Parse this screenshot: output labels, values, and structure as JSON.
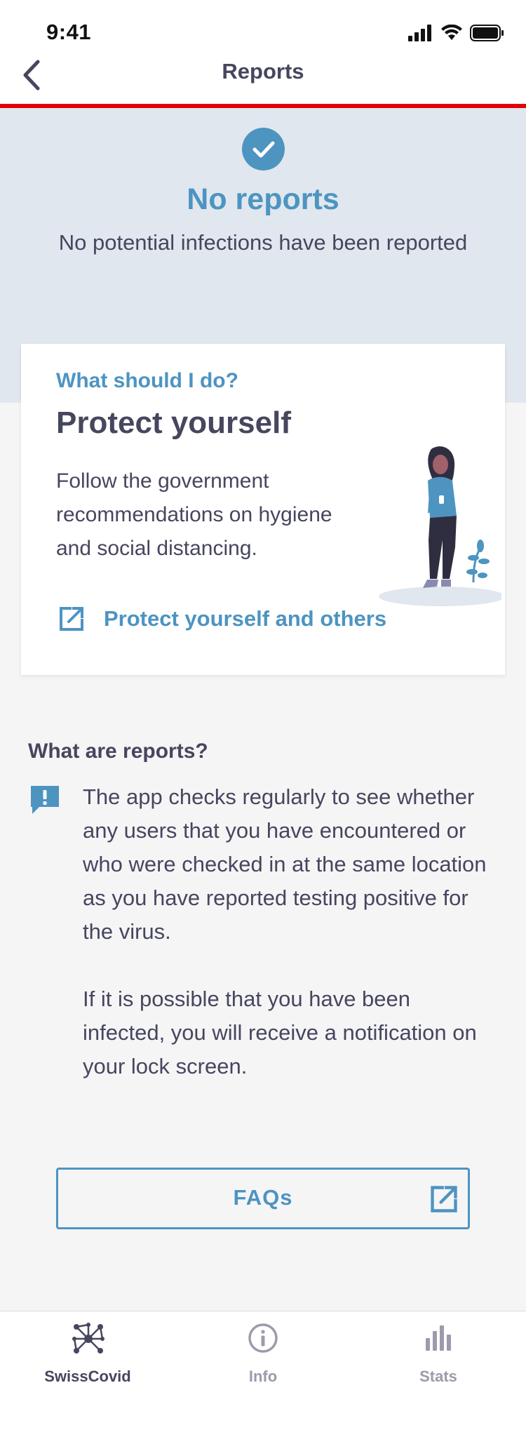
{
  "status_bar": {
    "time": "9:41"
  },
  "navbar": {
    "title": "Reports"
  },
  "header": {
    "title": "No reports",
    "subtitle": "No potential infections have been reported"
  },
  "card": {
    "eyebrow": "What should I do?",
    "title": "Protect yourself",
    "text": "Follow the government recommendations on hygiene and social distancing.",
    "link_label": "Protect yourself and others"
  },
  "info": {
    "title": "What are reports?",
    "paragraph1": "The app checks regularly to see whether any users that you have encountered or who were checked in at the same location as you have reported testing positive for the virus.",
    "paragraph2": "If it is possible that you have been infected, you will receive a notification on your lock screen."
  },
  "faq": {
    "label": "FAQs"
  },
  "tabs": [
    {
      "label": "SwissCovid",
      "icon": "swisscovid-icon",
      "active": true
    },
    {
      "label": "Info",
      "icon": "info-icon",
      "active": false
    },
    {
      "label": "Stats",
      "icon": "stats-icon",
      "active": false
    }
  ],
  "colors": {
    "accent": "#4d94c1",
    "text": "#46465f",
    "header_bg": "#e1e7ee",
    "red_line": "#e20008",
    "inactive_tab": "#9b9bab"
  }
}
